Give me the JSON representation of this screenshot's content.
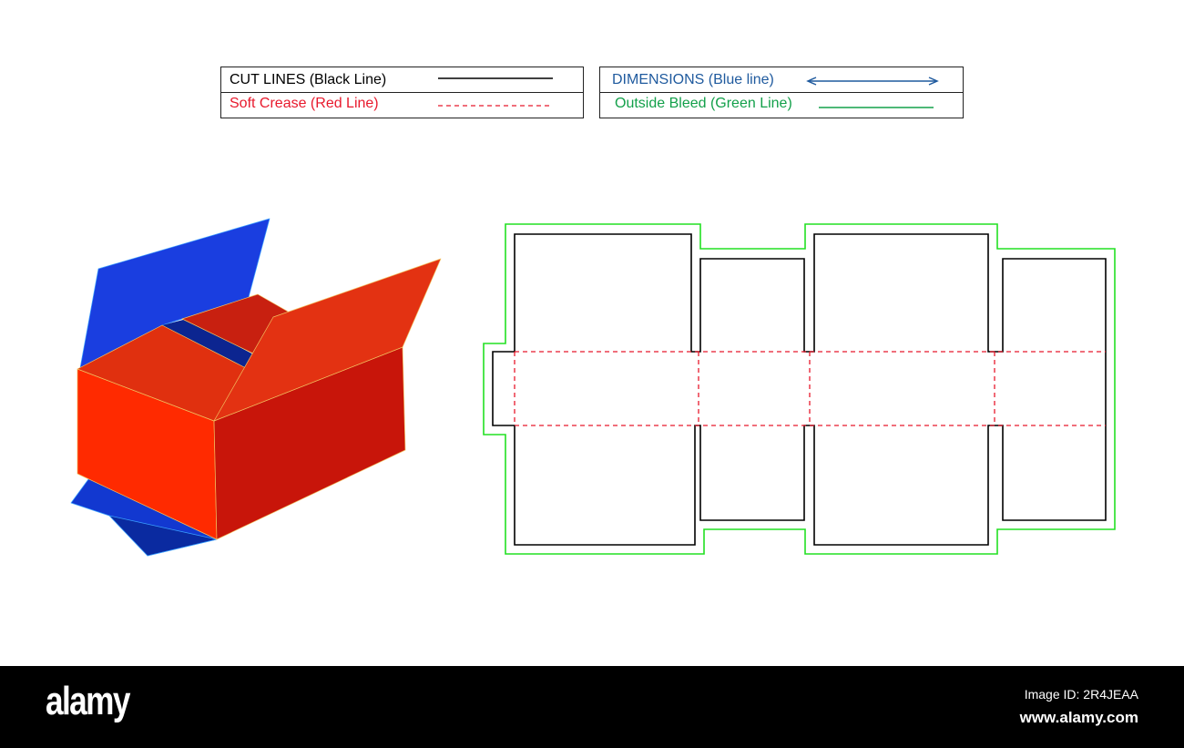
{
  "legend": {
    "cut_lines": "CUT LINES (Black Line)",
    "soft_crease": "Soft Crease (Red Line)",
    "dimensions": "DIMENSIONS (Blue line)",
    "outside_bleed": "Outside Bleed (Green Line)"
  },
  "colors": {
    "cut": "#000000",
    "crease": "#e8192c",
    "dimension": "#1f5a9e",
    "bleed": "#22e022",
    "box_front": "#ff2a00",
    "box_side": "#c8150a",
    "box_blue": "#1a3ee0"
  },
  "footer": {
    "logo": "alamy",
    "image_id": "Image ID: 2R4JEAA",
    "website": "www.alamy.com"
  }
}
